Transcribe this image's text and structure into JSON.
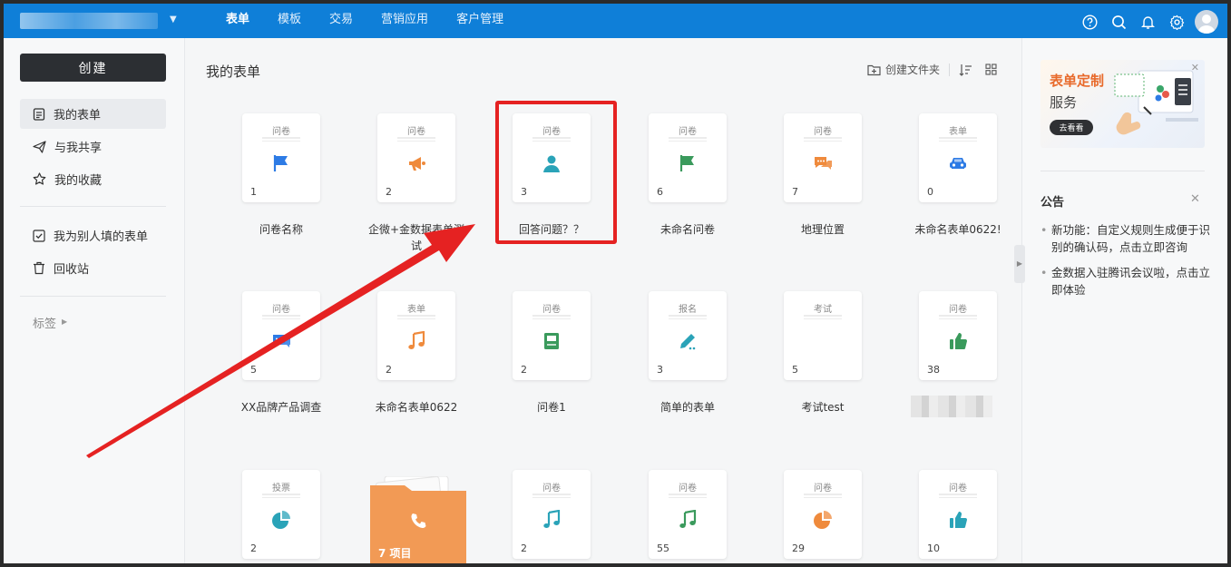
{
  "header": {
    "nav": [
      "表单",
      "模板",
      "交易",
      "营销应用",
      "客户管理"
    ],
    "active_nav": "表单",
    "brand_color": "#0f7fd8"
  },
  "sidebar": {
    "create_label": "创建",
    "items": [
      {
        "label": "我的表单",
        "icon": "document-icon",
        "active": true
      },
      {
        "label": "与我共享",
        "icon": "send-icon",
        "active": false
      },
      {
        "label": "我的收藏",
        "icon": "star-icon",
        "active": false
      },
      {
        "label": "我为别人填的表单",
        "icon": "checkbox-icon",
        "active": false
      },
      {
        "label": "回收站",
        "icon": "trash-icon",
        "active": false
      }
    ],
    "tags_label": "标签"
  },
  "main": {
    "title": "我的表单",
    "create_folder_label": "创建文件夹",
    "cards": [
      {
        "type": "问卷",
        "count": "1",
        "title": "问卷名称",
        "icon": "flag-icon",
        "color": "#2d7be5"
      },
      {
        "type": "问卷",
        "count": "2",
        "title": "企微+金数据表单测试",
        "icon": "megaphone-icon",
        "color": "#ef8a3c"
      },
      {
        "type": "问卷",
        "count": "3",
        "title": "回答问题？？",
        "icon": "user-icon",
        "color": "#2aa3b8"
      },
      {
        "type": "问卷",
        "count": "6",
        "title": "未命名问卷",
        "icon": "flag-icon",
        "color": "#3a9a5c"
      },
      {
        "type": "问卷",
        "count": "7",
        "title": "地理位置",
        "icon": "chat-icon",
        "color": "#ef8a3c"
      },
      {
        "type": "表单",
        "count": "0",
        "title": "未命名表单0622!",
        "icon": "car-icon",
        "color": "#2d7be5"
      },
      {
        "type": "问卷",
        "count": "5",
        "title": "XX品牌产品调查",
        "icon": "chat-icon",
        "color": "#2d7be5"
      },
      {
        "type": "表单",
        "count": "2",
        "title": "未命名表单0622",
        "icon": "music-icon",
        "color": "#ef8a3c"
      },
      {
        "type": "问卷",
        "count": "2",
        "title": "问卷1",
        "icon": "book-icon",
        "color": "#3a9a5c"
      },
      {
        "type": "报名",
        "count": "3",
        "title": "简单的表单",
        "icon": "pencil-icon",
        "color": "#2aa3b8"
      },
      {
        "type": "考试",
        "count": "5",
        "title": "考试test",
        "icon": "leaf-icon",
        "color": "#e0533a"
      },
      {
        "type": "问卷",
        "count": "38",
        "title": "",
        "icon": "thumbs-up-icon",
        "color": "#3a9a5c"
      },
      {
        "type": "投票",
        "count": "2",
        "title": "",
        "icon": "pie-icon",
        "color": "#2aa3b8"
      },
      {
        "type": "问卷",
        "count": "2",
        "title": "",
        "icon": "music-icon",
        "color": "#2aa3b8"
      },
      {
        "type": "问卷",
        "count": "55",
        "title": "",
        "icon": "music-icon",
        "color": "#3a9a5c"
      },
      {
        "type": "问卷",
        "count": "29",
        "title": "",
        "icon": "pie-icon",
        "color": "#ef8a3c"
      },
      {
        "type": "问卷",
        "count": "10",
        "title": "",
        "icon": "thumbs-up-icon",
        "color": "#2aa3b8"
      }
    ],
    "folder": {
      "label": "7 项目",
      "icon": "phone-icon",
      "color": "#f29a55"
    }
  },
  "right_panel": {
    "banner": {
      "title": "表单定制",
      "subtitle": "服务",
      "button": "去看看"
    },
    "notice_title": "公告",
    "notices": [
      "新功能：自定义规则生成便于识别的确认码，点击立即咨询",
      "金数据入驻腾讯会议啦，点击立即体验"
    ]
  },
  "annotation": {
    "highlight_color": "#e52222"
  }
}
